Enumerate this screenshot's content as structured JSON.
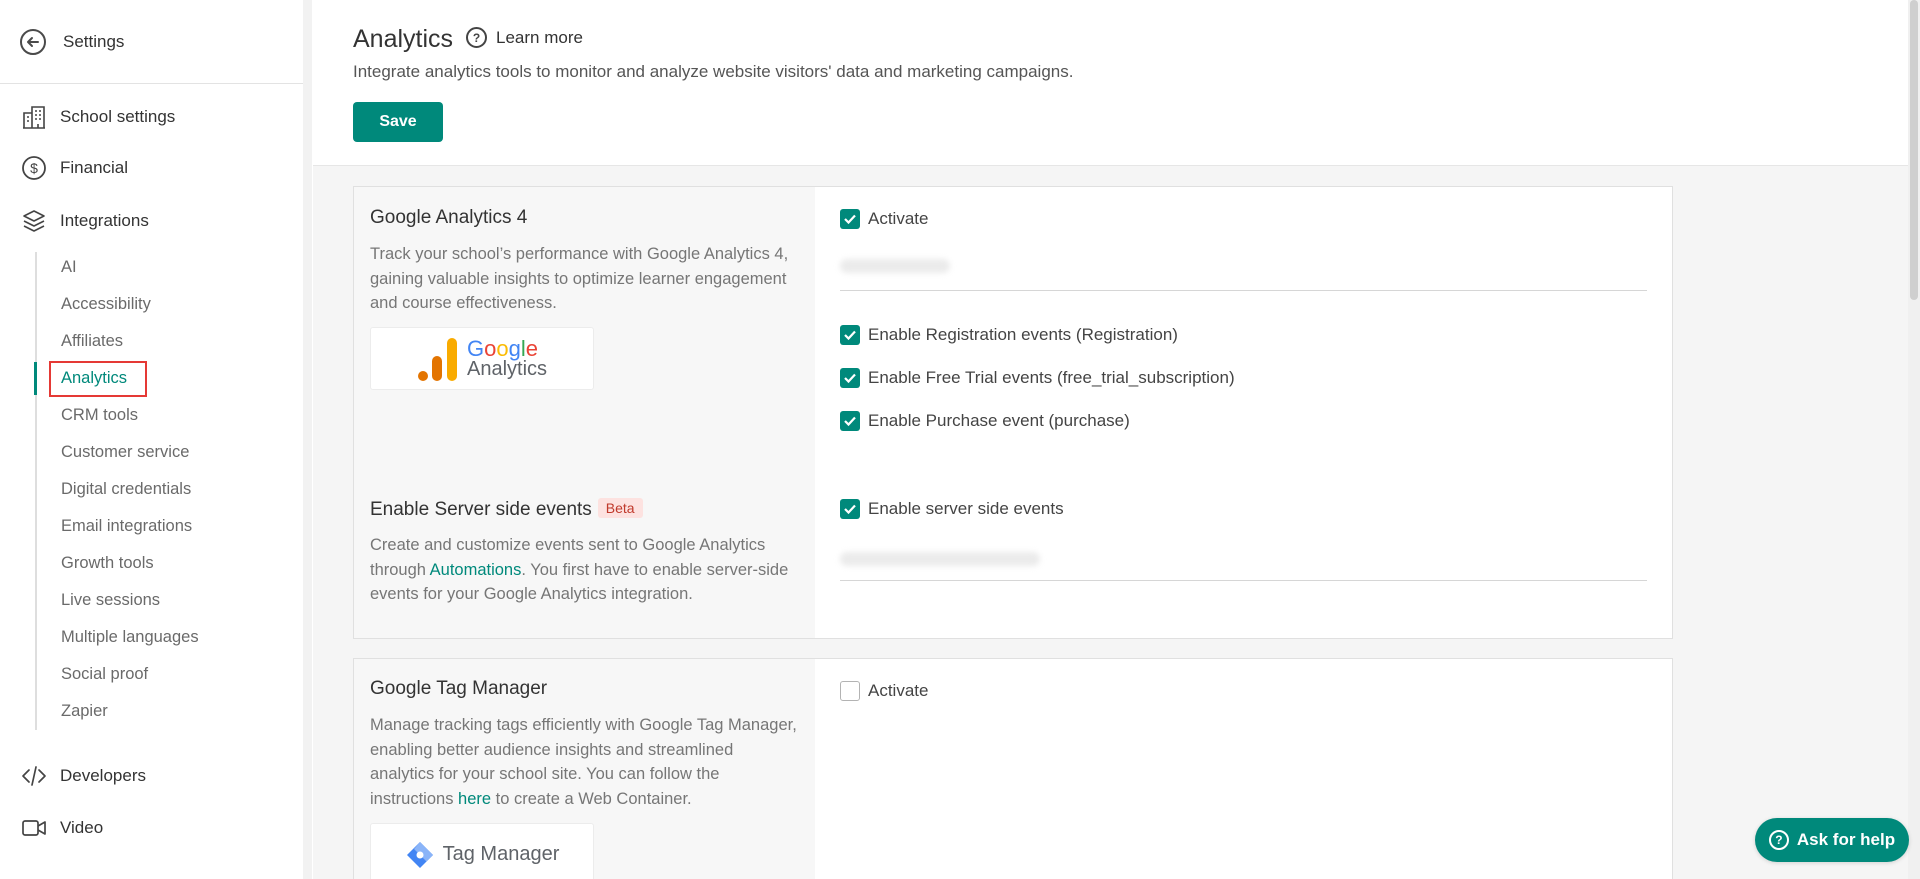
{
  "sidebar": {
    "back_label": "Settings",
    "top_items": [
      {
        "label": "School settings",
        "icon": "building-icon"
      },
      {
        "label": "Financial",
        "icon": "dollar-circle-icon"
      },
      {
        "label": "Integrations",
        "icon": "layers-icon"
      }
    ],
    "sub_items": [
      {
        "label": "AI"
      },
      {
        "label": "Accessibility"
      },
      {
        "label": "Affiliates"
      },
      {
        "label": "Analytics",
        "active": true
      },
      {
        "label": "CRM tools"
      },
      {
        "label": "Customer service"
      },
      {
        "label": "Digital credentials"
      },
      {
        "label": "Email integrations"
      },
      {
        "label": "Growth tools"
      },
      {
        "label": "Live sessions"
      },
      {
        "label": "Multiple languages"
      },
      {
        "label": "Social proof"
      },
      {
        "label": "Zapier"
      }
    ],
    "bottom_items": [
      {
        "label": "Developers",
        "icon": "code-icon"
      },
      {
        "label": "Video",
        "icon": "video-icon"
      }
    ]
  },
  "header": {
    "title": "Analytics",
    "learn_more": "Learn more",
    "subtitle": "Integrate analytics tools to monitor and analyze website visitors' data and marketing campaigns.",
    "save_label": "Save"
  },
  "ga4": {
    "title": "Google Analytics 4",
    "desc": "Track your school’s performance with Google Analytics 4, gaining valuable insights to optimize learner engagement and course effectiveness.",
    "logo_word1": "Google",
    "logo_word2": "Analytics",
    "activate": "Activate",
    "options": [
      "Enable Registration events (Registration)",
      "Enable Free Trial events (free_trial_subscription)",
      "Enable Purchase event (purchase)"
    ]
  },
  "server_side": {
    "title": "Enable Server side events",
    "beta": "Beta",
    "desc_before": "Create and customize events sent to Google Analytics through ",
    "desc_link": "Automations",
    "desc_after": ". You first have to enable server-side events for your Google Analytics integration.",
    "checkbox": "Enable server side events"
  },
  "gtm": {
    "title": "Google Tag Manager",
    "desc_before": "Manage tracking tags efficiently with Google Tag Manager, enabling better audience insights and streamlined analytics for your school site. You can follow the instructions ",
    "desc_link": "here",
    "desc_after": " to create a Web Container.",
    "activate": "Activate",
    "logo_text": "Tag Manager"
  },
  "ask_help": "Ask for help",
  "colors": {
    "accent": "#00897b",
    "highlight_border": "#e53935"
  }
}
